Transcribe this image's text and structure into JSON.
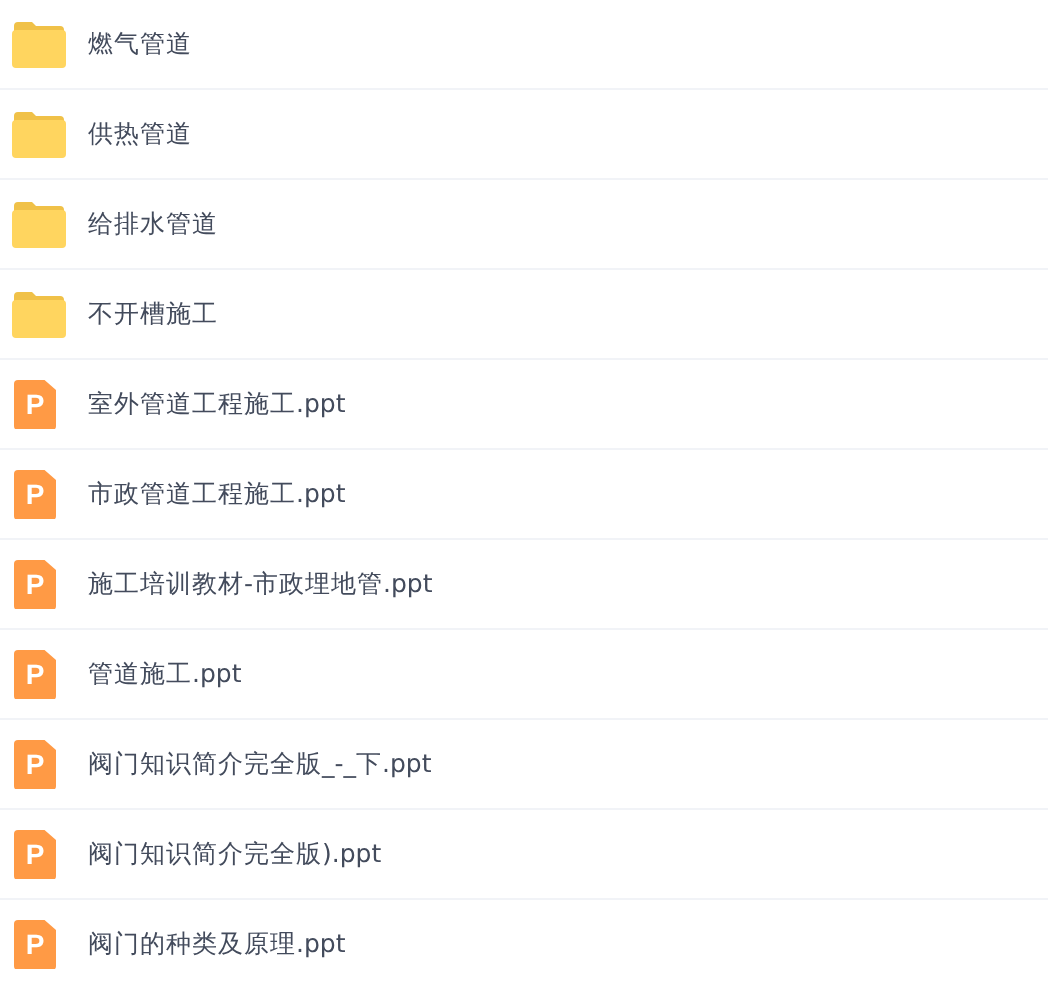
{
  "files": [
    {
      "kind": "folder",
      "name": "燃气管道"
    },
    {
      "kind": "folder",
      "name": "供热管道"
    },
    {
      "kind": "folder",
      "name": "给排水管道"
    },
    {
      "kind": "folder",
      "name": "不开槽施工"
    },
    {
      "kind": "ppt",
      "icon_text": "P",
      "name": "室外管道工程施工.ppt"
    },
    {
      "kind": "ppt",
      "icon_text": "P",
      "name": "市政管道工程施工.ppt"
    },
    {
      "kind": "ppt",
      "icon_text": "P",
      "name": "施工培训教材-市政埋地管.ppt"
    },
    {
      "kind": "ppt",
      "icon_text": "P",
      "name": "管道施工.ppt"
    },
    {
      "kind": "ppt",
      "icon_text": "P",
      "name": "阀门知识简介完全版_-_下.ppt"
    },
    {
      "kind": "ppt",
      "icon_text": "P",
      "name": "阀门知识简介完全版).ppt"
    },
    {
      "kind": "ppt",
      "icon_text": "P",
      "name": "阀门的种类及原理.ppt"
    }
  ]
}
